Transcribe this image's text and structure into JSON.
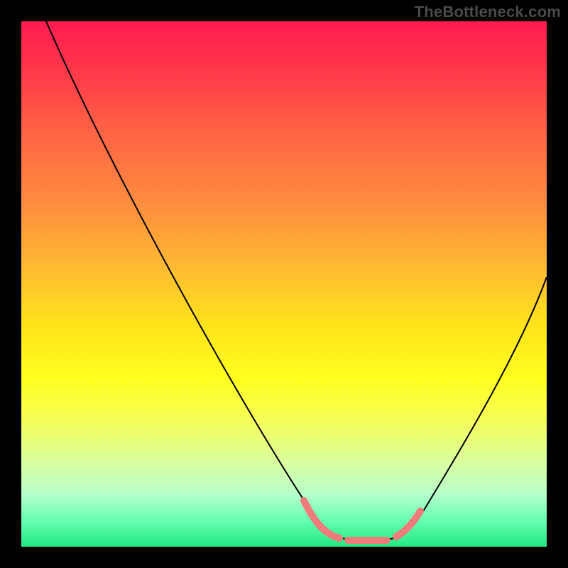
{
  "watermark": "TheBottleneck.com",
  "colors": {
    "frame_bg": "#000000",
    "curve": "#000000",
    "highlight": "#ef7b7b",
    "gradient_top": "#ff1a51",
    "gradient_bottom": "#22e884"
  },
  "chart_data": {
    "type": "line",
    "title": "",
    "xlabel": "",
    "ylabel": "",
    "xlim": [
      0,
      100
    ],
    "ylim": [
      0,
      100
    ],
    "grid": false,
    "legend": false,
    "series": [
      {
        "name": "bottleneck-curve",
        "x": [
          0,
          5,
          10,
          15,
          20,
          25,
          30,
          35,
          40,
          45,
          50,
          55,
          58,
          60,
          64,
          68,
          70,
          75,
          80,
          85,
          90,
          95,
          100
        ],
        "y": [
          100,
          92,
          84,
          76,
          68,
          60,
          52,
          44,
          36,
          28,
          20,
          12,
          7,
          4,
          2,
          2,
          4,
          9,
          17,
          26,
          35,
          45,
          56
        ]
      }
    ],
    "highlight_region": {
      "x_start": 55,
      "x_end": 70
    },
    "background_gradient": {
      "direction": "top-to-bottom",
      "stops": [
        {
          "pos": 0.0,
          "color": "#ff1a51"
        },
        {
          "pos": 0.58,
          "color": "#ffe41a"
        },
        {
          "pos": 0.84,
          "color": "#d9ffa0"
        },
        {
          "pos": 1.0,
          "color": "#22e884"
        }
      ]
    }
  }
}
